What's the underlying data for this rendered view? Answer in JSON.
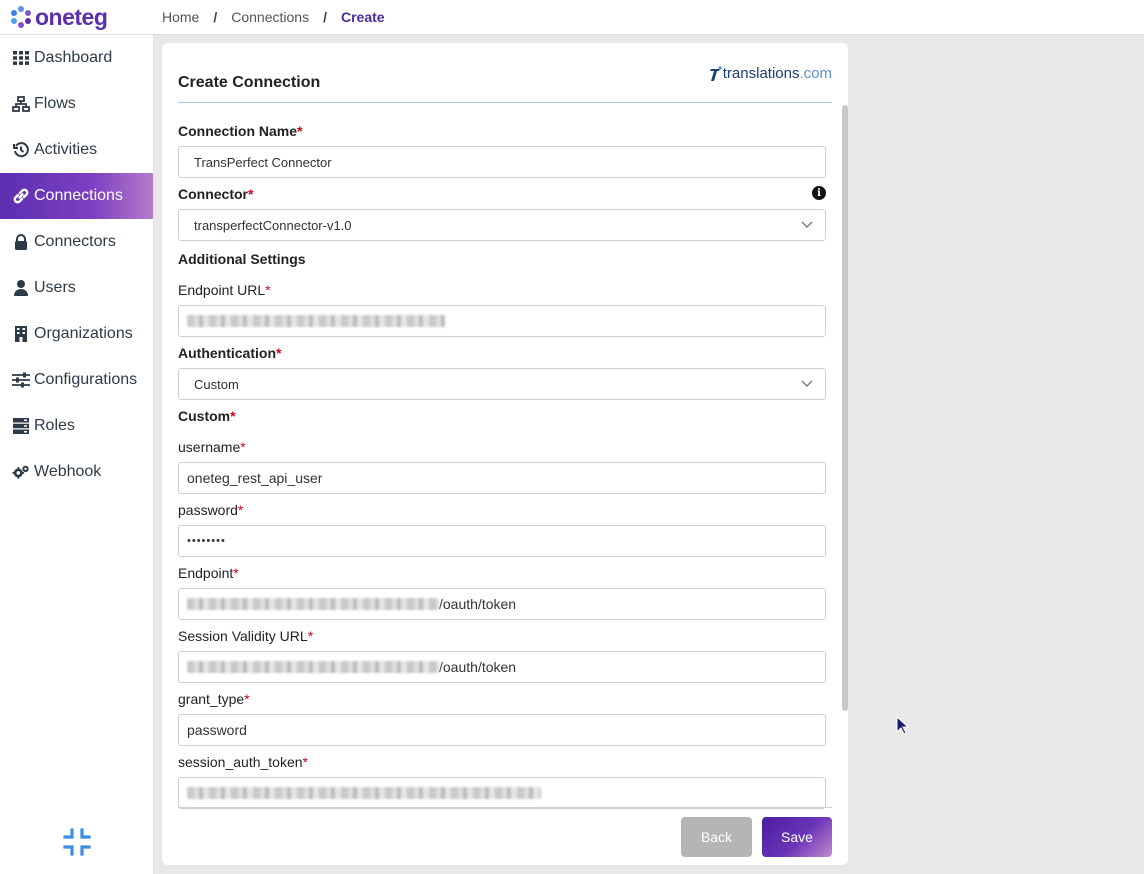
{
  "app": {
    "brand": "oneteg"
  },
  "breadcrumb": [
    "Home",
    "Connections",
    "Create"
  ],
  "sidebar": {
    "items": [
      {
        "label": "Dashboard",
        "icon": "grid-icon",
        "active": false
      },
      {
        "label": "Flows",
        "icon": "sitemap-icon",
        "active": false
      },
      {
        "label": "Activities",
        "icon": "history-icon",
        "active": false
      },
      {
        "label": "Connections",
        "icon": "link-icon",
        "active": true
      },
      {
        "label": "Connectors",
        "icon": "lock-icon",
        "active": false
      },
      {
        "label": "Users",
        "icon": "user-icon",
        "active": false
      },
      {
        "label": "Organizations",
        "icon": "building-icon",
        "active": false
      },
      {
        "label": "Configurations",
        "icon": "sliders-icon",
        "active": false
      },
      {
        "label": "Roles",
        "icon": "server-icon",
        "active": false
      },
      {
        "label": "Webhook",
        "icon": "gears-icon",
        "active": false
      }
    ],
    "collapse_icon": "compress-icon"
  },
  "card": {
    "title": "Create Connection",
    "partner_logo": {
      "name": "translations",
      "suffix": ".com"
    }
  },
  "form": {
    "connection_name": {
      "label": "Connection Name",
      "value": "TransPerfect Connector"
    },
    "connector": {
      "label": "Connector",
      "value": "transperfectConnector-v1.0"
    },
    "additional_settings": "Additional Settings",
    "endpoint_url": {
      "label": "Endpoint URL"
    },
    "authentication": {
      "label": "Authentication",
      "value": "Custom"
    },
    "custom_section": "Custom",
    "username": {
      "label": "username",
      "value": "oneteg_rest_api_user"
    },
    "password": {
      "label": "password",
      "value": "••••••••"
    },
    "endpoint": {
      "label": "Endpoint",
      "suffix": "/oauth/token"
    },
    "session_validity_url": {
      "label": "Session Validity URL",
      "suffix": "/oauth/token"
    },
    "grant_type": {
      "label": "grant_type",
      "value": "password"
    },
    "session_auth_token": {
      "label": "session_auth_token"
    },
    "required_mark": "*"
  },
  "buttons": {
    "back": "Back",
    "save": "Save"
  },
  "colors": {
    "accent": "#5a2fb0",
    "required": "#d0021b",
    "header_rule": "#a9c4e2"
  }
}
